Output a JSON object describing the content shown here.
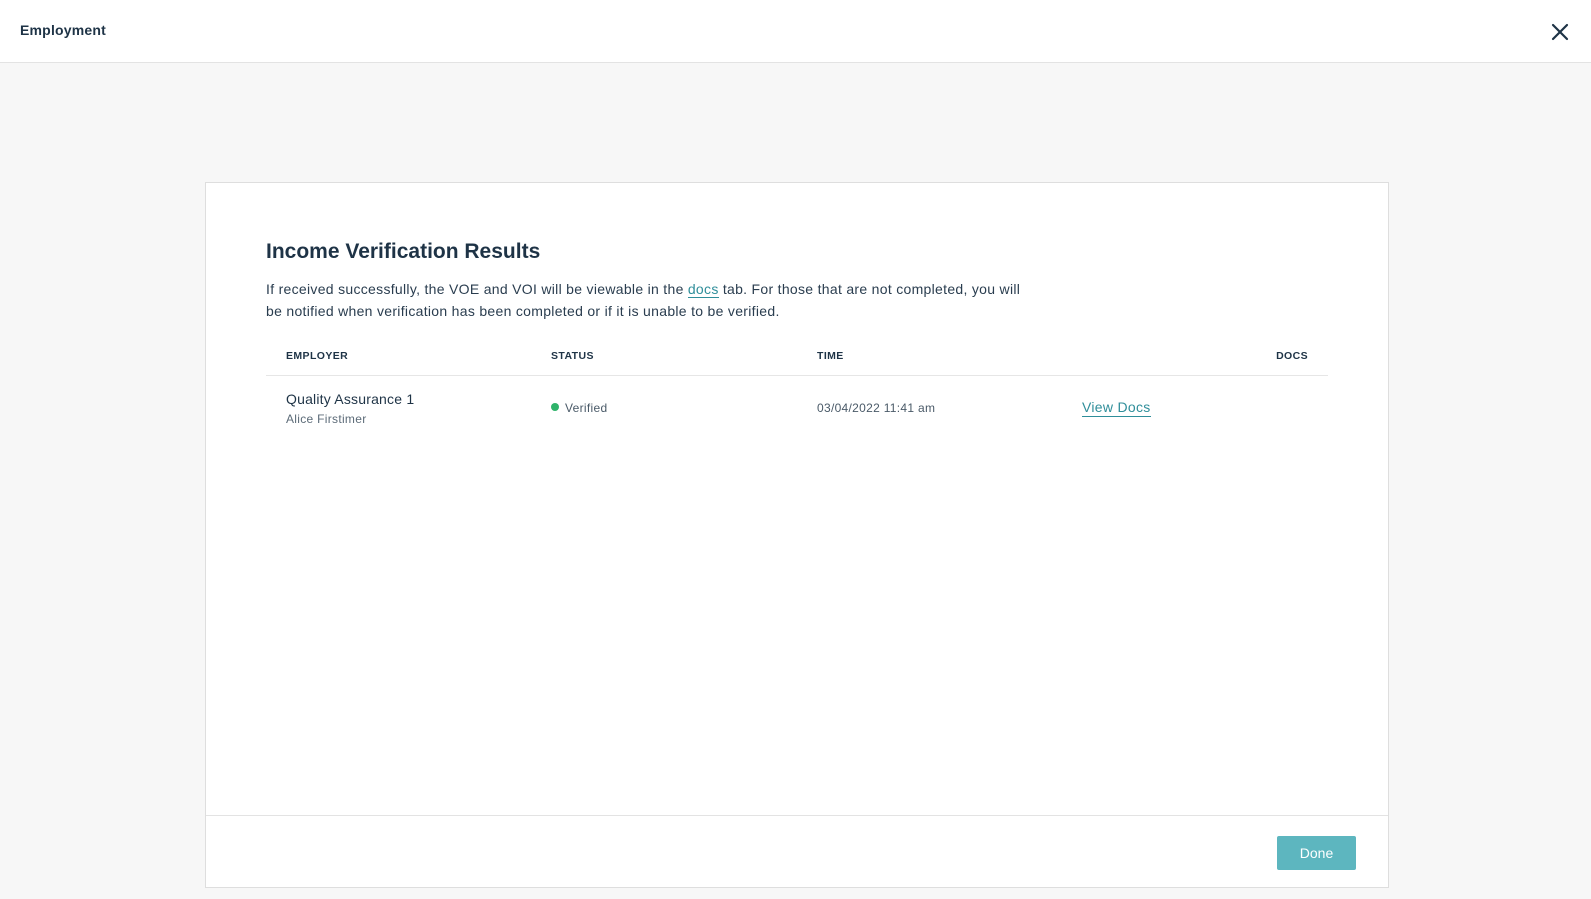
{
  "header": {
    "title": "Employment",
    "close_icon": "close-icon"
  },
  "card": {
    "title": "Income Verification Results",
    "description": {
      "before_link": "If received successfully, the VOE and VOI will be viewable in the ",
      "link_text": "docs",
      "after_link": " tab. For those that are not completed, you will be notified when verification has been completed or if it is unable to be verified."
    },
    "table": {
      "columns": [
        "EMPLOYER",
        "STATUS",
        "TIME",
        "DOCS"
      ],
      "rows": [
        {
          "employer": "Quality Assurance 1",
          "borrower": "Alice Firstimer",
          "status": "Verified",
          "status_color": "#2fb36a",
          "time": "03/04/2022 11:41 am",
          "docs_link": "View Docs"
        }
      ]
    },
    "footer": {
      "done_label": "Done"
    }
  },
  "colors": {
    "accent": "#2f8e9a",
    "button": "#5db6bf",
    "text": "#1e3346"
  }
}
